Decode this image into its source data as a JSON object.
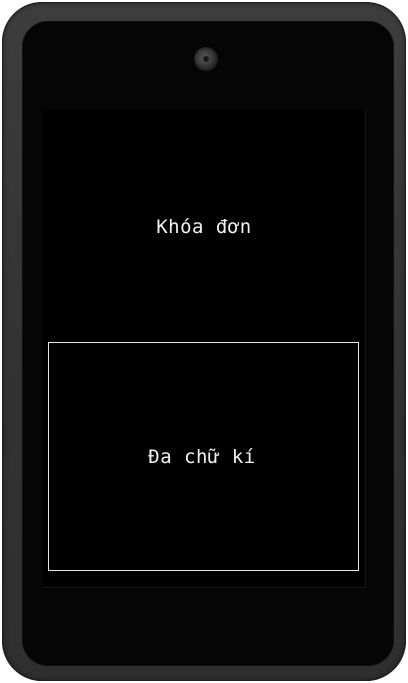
{
  "screen": {
    "lock_text": "Khóa đơn",
    "signature_text": "Đa chữ kí"
  },
  "device": {
    "camera_icon": "camera-icon"
  },
  "colors": {
    "screen_background": "#000000",
    "device_frame": "#363636",
    "text": "#f2f2f2",
    "signature_border": "#e8e8e8"
  }
}
